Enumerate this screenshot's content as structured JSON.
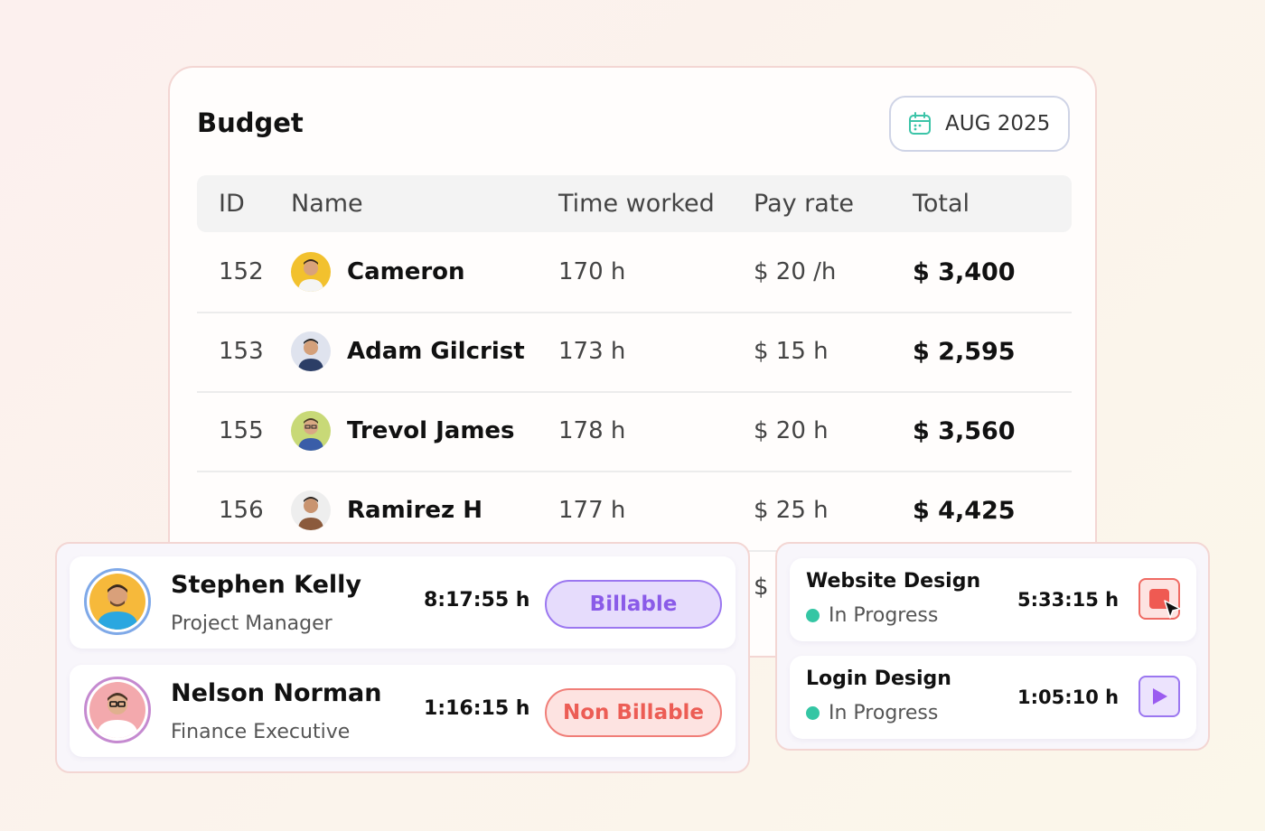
{
  "budget": {
    "title": "Budget",
    "date_label": "AUG 2025",
    "columns": [
      "ID",
      "Name",
      "Time worked",
      "Pay rate",
      "Total"
    ],
    "rows": [
      {
        "id": "152",
        "name": "Cameron",
        "time": "170 h",
        "rate": "$ 20 /h",
        "total": "$ 3,400"
      },
      {
        "id": "153",
        "name": "Adam Gilcrist",
        "time": "173 h",
        "rate": "$ 15 h",
        "total": "$ 2,595"
      },
      {
        "id": "155",
        "name": "Trevol James",
        "time": "178 h",
        "rate": "$ 20 h",
        "total": "$ 3,560"
      },
      {
        "id": "156",
        "name": "Ramirez H",
        "time": "177 h",
        "rate": "$ 25 h",
        "total": "$ 4,425"
      }
    ],
    "partial_row_text": "$"
  },
  "people": [
    {
      "name": "Stephen Kelly",
      "role": "Project Manager",
      "time": "8:17:55 h",
      "badge": "Billable"
    },
    {
      "name": "Nelson Norman",
      "role": "Finance Executive",
      "time": "1:16:15 h",
      "badge": "Non Billable"
    }
  ],
  "tasks": [
    {
      "name": "Website Design",
      "status": "In Progress",
      "time": "5:33:15 h",
      "action": "stop"
    },
    {
      "name": "Login Design",
      "status": "In Progress",
      "time": "1:05:10 h",
      "action": "play"
    }
  ],
  "icons": {
    "date": "calendar-icon",
    "stop": "stop-icon",
    "play": "play-icon",
    "cursor": "cursor-icon",
    "status_dot": "status-dot"
  },
  "colors": {
    "billable": "#8a5be8",
    "non_billable": "#ec5d55",
    "in_progress": "#34c6a4",
    "calendar_icon": "#3cc4a8"
  }
}
